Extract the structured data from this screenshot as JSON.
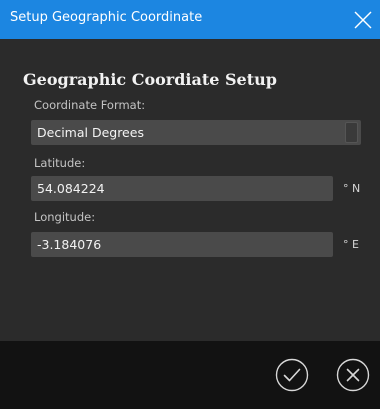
{
  "window": {
    "title": "Setup Geographic Coordinate"
  },
  "form": {
    "heading": "Geographic Coordiate Setup",
    "format_label": "Coordinate Format:",
    "format_value": "Decimal Degrees",
    "latitude_label": "Latitude:",
    "latitude_value": "54.084224",
    "latitude_unit": "° N",
    "longitude_label": "Longitude:",
    "longitude_value": "-3.184076",
    "longitude_unit": "° E"
  },
  "icons": {
    "close": "close-icon",
    "confirm": "checkmark-circle-icon",
    "cancel": "x-circle-icon"
  },
  "colors": {
    "titlebar": "#1c86e1",
    "panel": "#2b2b2b",
    "footer": "#121212",
    "field": "#4a4a4a"
  }
}
